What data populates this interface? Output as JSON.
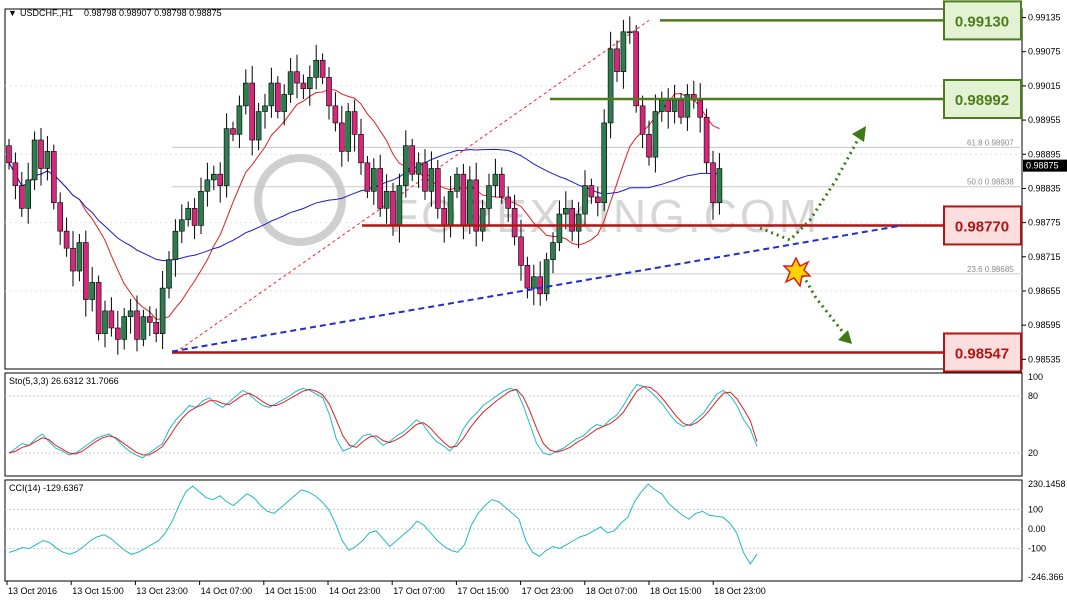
{
  "header": {
    "symbol": "USDCHF.,H1",
    "ohlc": "0.98798 0.98907 0.98798 0.98875"
  },
  "colors": {
    "bull": "#2e7d4f",
    "bear": "#d6287a",
    "ma_fast": "#e02020",
    "ma_slow": "#1a1acc",
    "support": "#b21414",
    "resistance": "#4d7c1c",
    "trendline": "#1c2fd0",
    "stoch_main": "#20b8c8",
    "stoch_signal": "#e02020",
    "cci": "#20b8c8"
  },
  "chart_data": [
    {
      "type": "candlestick",
      "symbol": "USDCHF",
      "timeframe": "H1",
      "price_axis_ticks": [
        "0.99135",
        "0.99075",
        "0.99015",
        "0.98955",
        "0.98895",
        "0.98835",
        "0.98775",
        "0.98715",
        "0.98655",
        "0.98595",
        "0.98535"
      ],
      "ylim": [
        0.98518,
        0.9915
      ],
      "current_price": "0.98875",
      "x_tick_labels": [
        "13 Oct 2016",
        "13 Oct 15:00",
        "13 Oct 23:00",
        "14 Oct 07:00",
        "14 Oct 15:00",
        "14 Oct 23:00",
        "17 Oct 07:00",
        "17 Oct 15:00",
        "17 Oct 23:00",
        "18 Oct 07:00",
        "18 Oct 15:00",
        "18 Oct 23:00"
      ],
      "fib_levels": [
        {
          "label": "61.8 0.98907",
          "value": 0.98907
        },
        {
          "label": "50.0 0.98838",
          "value": 0.98838
        },
        {
          "label": "23.6 0.98685",
          "value": 0.98685
        }
      ],
      "levels": [
        {
          "label": "0.99130",
          "value": 0.9913,
          "kind": "resistance"
        },
        {
          "label": "0.98992",
          "value": 0.98992,
          "kind": "resistance"
        },
        {
          "label": "0.98770",
          "value": 0.9877,
          "kind": "support"
        },
        {
          "label": "0.98547",
          "value": 0.98547,
          "kind": "support"
        }
      ],
      "trendline": {
        "from": 0.98547,
        "to": 0.9877
      },
      "watermark": "FOREXKING.COM",
      "closes": [
        0.9888,
        0.9884,
        0.988,
        0.9885,
        0.9892,
        0.9887,
        0.989,
        0.9881,
        0.9876,
        0.9873,
        0.9869,
        0.9874,
        0.9864,
        0.9867,
        0.9858,
        0.9862,
        0.9859,
        0.9857,
        0.9861,
        0.9862,
        0.9857,
        0.9861,
        0.986,
        0.9858,
        0.9866,
        0.9871,
        0.9876,
        0.9878,
        0.988,
        0.9877,
        0.9883,
        0.9885,
        0.9886,
        0.9884,
        0.9894,
        0.9893,
        0.9898,
        0.9902,
        0.9892,
        0.9897,
        0.9898,
        0.9902,
        0.9897,
        0.99,
        0.9904,
        0.9902,
        0.9901,
        0.9903,
        0.9906,
        0.9903,
        0.9898,
        0.9895,
        0.989,
        0.9897,
        0.9893,
        0.9888,
        0.9883,
        0.9887,
        0.988,
        0.9883,
        0.9877,
        0.9884,
        0.9891,
        0.9886,
        0.9888,
        0.9883,
        0.9887,
        0.988,
        0.9877,
        0.9883,
        0.9886,
        0.9877,
        0.9885,
        0.9876,
        0.988,
        0.9884,
        0.9886,
        0.9882,
        0.988,
        0.9875,
        0.987,
        0.9866,
        0.9868,
        0.9865,
        0.9871,
        0.9874,
        0.9879,
        0.988,
        0.9876,
        0.9879,
        0.9884,
        0.9882,
        0.9881,
        0.9895,
        0.9908,
        0.9904,
        0.9911,
        0.9911,
        0.9898,
        0.9893,
        0.9889,
        0.9897,
        0.9899,
        0.9897,
        0.9899,
        0.9896,
        0.99,
        0.9899,
        0.9896,
        0.9888,
        0.9881,
        0.9887
      ],
      "stochastic": {
        "label": "Sto(5,3,3) 26.6312 31.7066",
        "ylim": [
          0,
          100
        ],
        "levels": [
          80,
          20
        ],
        "main": [
          20,
          25,
          30,
          28,
          35,
          40,
          32,
          25,
          22,
          18,
          20,
          25,
          30,
          35,
          38,
          40,
          35,
          28,
          22,
          18,
          15,
          20,
          25,
          30,
          45,
          55,
          62,
          70,
          68,
          75,
          78,
          72,
          68,
          74,
          80,
          86,
          82,
          75,
          70,
          68,
          72,
          76,
          80,
          85,
          88,
          86,
          82,
          78,
          60,
          35,
          22,
          25,
          30,
          38,
          40,
          35,
          28,
          32,
          38,
          42,
          48,
          55,
          50,
          40,
          32,
          28,
          22,
          30,
          45,
          55,
          62,
          70,
          75,
          80,
          85,
          88,
          86,
          70,
          50,
          30,
          20,
          18,
          22,
          25,
          30,
          35,
          38,
          45,
          50,
          48,
          55,
          60,
          70,
          82,
          92,
          90,
          85,
          78,
          70,
          60,
          52,
          48,
          50,
          56,
          62,
          72,
          82,
          86,
          80,
          70,
          55,
          45,
          27
        ],
        "signal": [
          20,
          22,
          26,
          28,
          32,
          36,
          34,
          28,
          24,
          20,
          19,
          22,
          27,
          32,
          36,
          38,
          36,
          31,
          26,
          21,
          18,
          18,
          22,
          27,
          37,
          48,
          57,
          64,
          68,
          71,
          75,
          75,
          72,
          71,
          76,
          81,
          83,
          79,
          74,
          70,
          70,
          73,
          77,
          81,
          85,
          87,
          85,
          81,
          71,
          55,
          38,
          28,
          26,
          32,
          37,
          38,
          33,
          31,
          34,
          38,
          44,
          50,
          52,
          47,
          39,
          32,
          26,
          27,
          35,
          46,
          55,
          63,
          69,
          75,
          80,
          85,
          87,
          79,
          64,
          46,
          30,
          23,
          21,
          23,
          26,
          31,
          35,
          40,
          45,
          48,
          51,
          56,
          63,
          74,
          85,
          90,
          89,
          84,
          76,
          67,
          58,
          51,
          49,
          52,
          58,
          66,
          75,
          83,
          84,
          77,
          66,
          54,
          32
        ]
      },
      "cci": {
        "label": "CCI(14) -129.6367",
        "ticks": [
          "230.1458",
          "100",
          "0.00",
          "-100",
          "-246.366"
        ],
        "ylim": [
          -246.366,
          230.1458
        ],
        "values": [
          -120,
          -110,
          -95,
          -100,
          -80,
          -60,
          -70,
          -100,
          -120,
          -130,
          -115,
          -90,
          -60,
          -40,
          -30,
          -50,
          -80,
          -110,
          -130,
          -120,
          -100,
          -80,
          -60,
          -20,
          40,
          120,
          190,
          220,
          190,
          160,
          150,
          170,
          140,
          120,
          150,
          180,
          160,
          120,
          90,
          80,
          110,
          140,
          170,
          200,
          190,
          170,
          140,
          100,
          30,
          -60,
          -110,
          -90,
          -60,
          -20,
          -10,
          -50,
          -90,
          -60,
          -30,
          0,
          40,
          20,
          -20,
          -60,
          -90,
          -110,
          -120,
          -80,
          20,
          80,
          120,
          150,
          140,
          110,
          80,
          50,
          -60,
          -120,
          -140,
          -110,
          -90,
          -100,
          -80,
          -60,
          -40,
          -30,
          -10,
          10,
          -20,
          -10,
          30,
          60,
          140,
          190,
          230,
          200,
          180,
          130,
          100,
          70,
          50,
          80,
          90,
          70,
          65,
          60,
          30,
          -20,
          -120,
          -180,
          -129.6
        ]
      }
    }
  ]
}
